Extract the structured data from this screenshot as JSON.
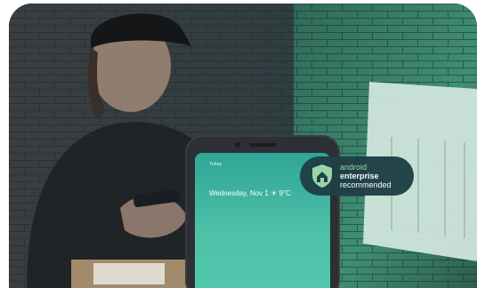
{
  "image": {
    "phone": {
      "status": "Today",
      "date": "Wednesday, Nov 1 ☀ 9°C"
    },
    "badge": {
      "line1": "android",
      "line2": "enterprise",
      "line3": "recommended",
      "icon": "shield-home-icon"
    },
    "colors": {
      "badge_bg": "#1f3f47",
      "badge_accent": "#9fd9a8",
      "screen_teal": "#4ec0a8",
      "wall_green": "#3c8a6a"
    }
  }
}
